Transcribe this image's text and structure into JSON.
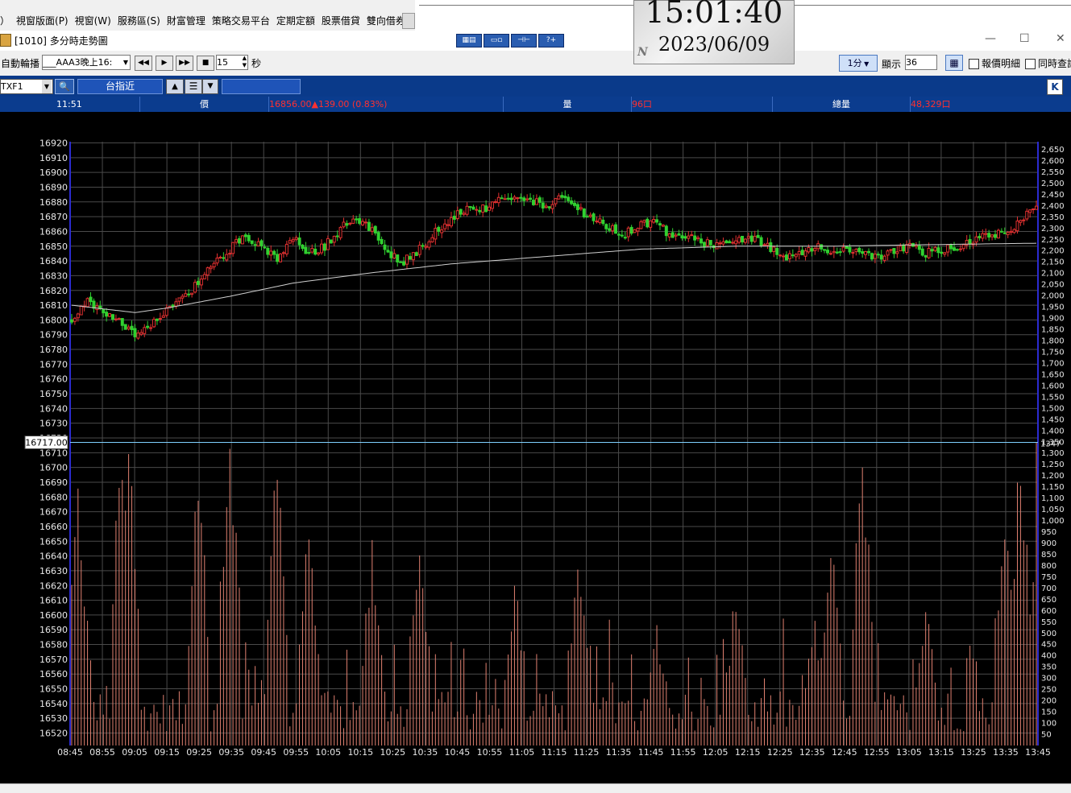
{
  "menu": {
    "items": [
      "）",
      "視窗版面(P)",
      "視窗(W)",
      "服務區(S)",
      "財富管理",
      "策略交易平台",
      "定期定額",
      "股票借貸",
      "雙向借券"
    ]
  },
  "clock": {
    "time": "15:01:40",
    "date": "2023/06/09",
    "badge": "N"
  },
  "window": {
    "title": "[1010] 多分時走勢圖",
    "min": "—",
    "max": "☐",
    "close": "✕"
  },
  "toolbar": {
    "auto_rotate": "自動輪播",
    "list_value": "___AAA3晚上16:",
    "interval_value": "15",
    "seconds_label": "秒",
    "period": "1分",
    "show_label": "顯示",
    "show_value": "36",
    "quote_detail": "報價明細",
    "sync_query": "同時查詢"
  },
  "symbol_bar": {
    "code": "TXF1",
    "name": "台指近",
    "k_btn": "K"
  },
  "info": {
    "time": "11:51",
    "price_label": "價",
    "price_value": "16856.00▲139.00 (0.83%)",
    "vol_label": "量",
    "vol_value": "96口",
    "total_label": "總量",
    "total_value": "48,329口"
  },
  "cursor": {
    "price_label": "16717.00",
    "vol_label": "1347"
  },
  "colors": {
    "up": "#e03030",
    "down": "#30d030",
    "ma": "#cfcfcf",
    "volume": "#e08070",
    "axis": "#2b2bd0",
    "grid": "#4a4a4a",
    "cursor": "#7fd0ff"
  },
  "chart_data": {
    "type": "candlestick",
    "price_axis": {
      "min": 16520,
      "max": 16920,
      "step": 10
    },
    "volume_axis": {
      "min": 50,
      "max": 2650,
      "step": 50
    },
    "time_labels": [
      "08:45",
      "08:55",
      "09:05",
      "09:15",
      "09:25",
      "09:35",
      "09:45",
      "09:55",
      "10:05",
      "10:15",
      "10:25",
      "10:35",
      "10:45",
      "10:55",
      "11:05",
      "11:15",
      "11:25",
      "11:35",
      "11:45",
      "11:55",
      "12:05",
      "12:15",
      "12:25",
      "12:35",
      "12:45",
      "12:55",
      "13:05",
      "13:15",
      "13:25",
      "13:35",
      "13:45"
    ],
    "close_keypoints": [
      [
        0,
        16800
      ],
      [
        5,
        16812
      ],
      [
        10,
        16806
      ],
      [
        15,
        16800
      ],
      [
        20,
        16788
      ],
      [
        25,
        16795
      ],
      [
        30,
        16808
      ],
      [
        35,
        16815
      ],
      [
        40,
        16825
      ],
      [
        45,
        16838
      ],
      [
        50,
        16848
      ],
      [
        55,
        16858
      ],
      [
        60,
        16850
      ],
      [
        65,
        16840
      ],
      [
        70,
        16855
      ],
      [
        75,
        16845
      ],
      [
        80,
        16850
      ],
      [
        85,
        16862
      ],
      [
        90,
        16870
      ],
      [
        95,
        16860
      ],
      [
        100,
        16845
      ],
      [
        105,
        16840
      ],
      [
        110,
        16848
      ],
      [
        115,
        16860
      ],
      [
        120,
        16868
      ],
      [
        125,
        16876
      ],
      [
        130,
        16875
      ],
      [
        135,
        16880
      ],
      [
        140,
        16882
      ],
      [
        145,
        16880
      ],
      [
        150,
        16878
      ],
      [
        155,
        16882
      ],
      [
        160,
        16876
      ],
      [
        165,
        16868
      ],
      [
        170,
        16862
      ],
      [
        175,
        16858
      ],
      [
        180,
        16865
      ],
      [
        185,
        16866
      ],
      [
        190,
        16855
      ],
      [
        195,
        16858
      ],
      [
        200,
        16852
      ],
      [
        205,
        16850
      ],
      [
        210,
        16856
      ],
      [
        215,
        16855
      ],
      [
        220,
        16850
      ],
      [
        225,
        16842
      ],
      [
        230,
        16846
      ],
      [
        235,
        16850
      ],
      [
        240,
        16848
      ],
      [
        245,
        16846
      ],
      [
        250,
        16845
      ],
      [
        255,
        16842
      ],
      [
        260,
        16846
      ],
      [
        265,
        16852
      ],
      [
        270,
        16845
      ],
      [
        275,
        16848
      ],
      [
        280,
        16850
      ],
      [
        285,
        16855
      ],
      [
        290,
        16858
      ],
      [
        295,
        16860
      ],
      [
        300,
        16866
      ],
      [
        305,
        16878
      ]
    ],
    "ma_keypoints": [
      [
        0,
        16810
      ],
      [
        20,
        16805
      ],
      [
        30,
        16808
      ],
      [
        50,
        16816
      ],
      [
        70,
        16825
      ],
      [
        95,
        16832
      ],
      [
        120,
        16838
      ],
      [
        150,
        16843
      ],
      [
        180,
        16848
      ],
      [
        210,
        16850
      ],
      [
        240,
        16850
      ],
      [
        270,
        16851
      ],
      [
        305,
        16852
      ]
    ],
    "volume_peaks": [
      [
        2,
        1250
      ],
      [
        16,
        1620
      ],
      [
        18,
        1560
      ],
      [
        40,
        1320
      ],
      [
        50,
        1620
      ],
      [
        65,
        1500
      ],
      [
        75,
        1170
      ],
      [
        95,
        980
      ],
      [
        110,
        1000
      ],
      [
        140,
        860
      ],
      [
        160,
        950
      ],
      [
        185,
        620
      ],
      [
        210,
        780
      ],
      [
        235,
        620
      ],
      [
        240,
        1000
      ],
      [
        250,
        1520
      ],
      [
        270,
        760
      ],
      [
        295,
        1270
      ],
      [
        300,
        1460
      ],
      [
        305,
        1050
      ]
    ]
  }
}
